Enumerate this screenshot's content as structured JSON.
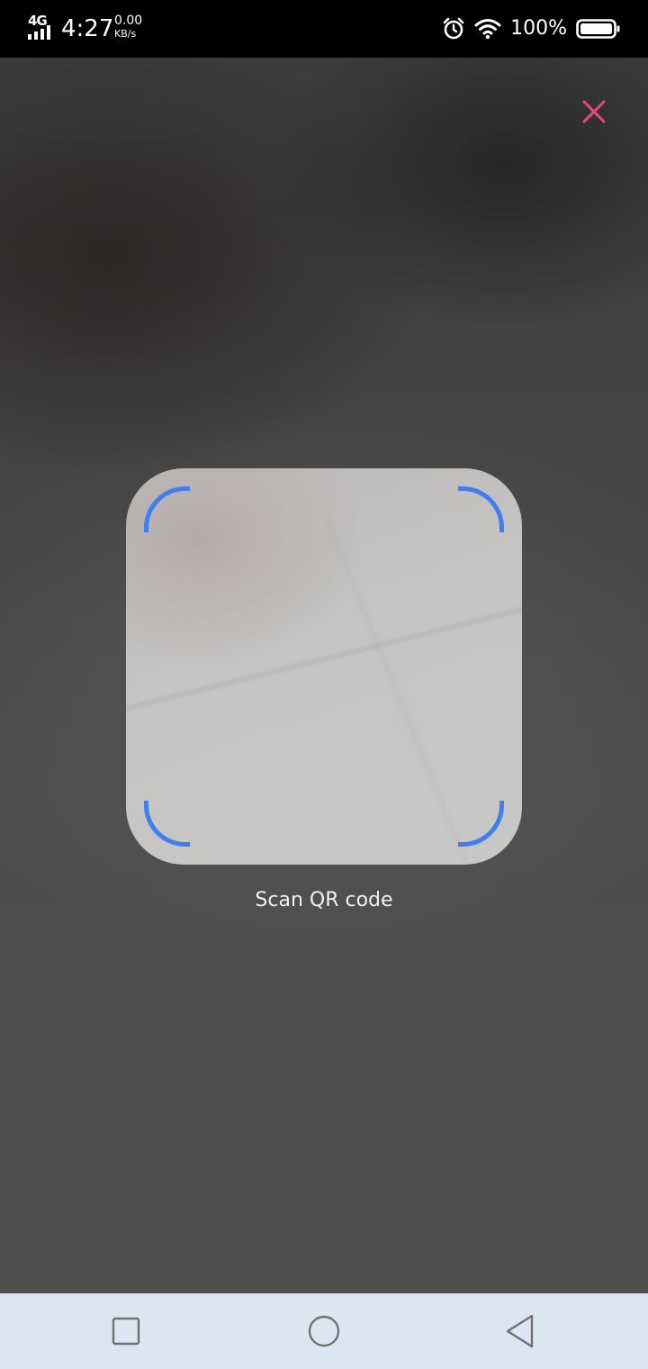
{
  "status_bar": {
    "network_type": "4G",
    "time": "4:27",
    "data_speed_value": "0.00",
    "data_speed_unit": "KB/s",
    "battery_percent": "100%",
    "icons": [
      "signal-icon",
      "alarm-icon",
      "wifi-icon",
      "battery-icon"
    ]
  },
  "scanner": {
    "label": "Scan QR code",
    "close_icon": "close-icon",
    "accent_color": "#3f7df0",
    "close_color": "#e8487a"
  },
  "nav_bar": {
    "buttons": [
      "recents-icon",
      "home-icon",
      "back-icon"
    ],
    "background": "#dbe6f3"
  }
}
